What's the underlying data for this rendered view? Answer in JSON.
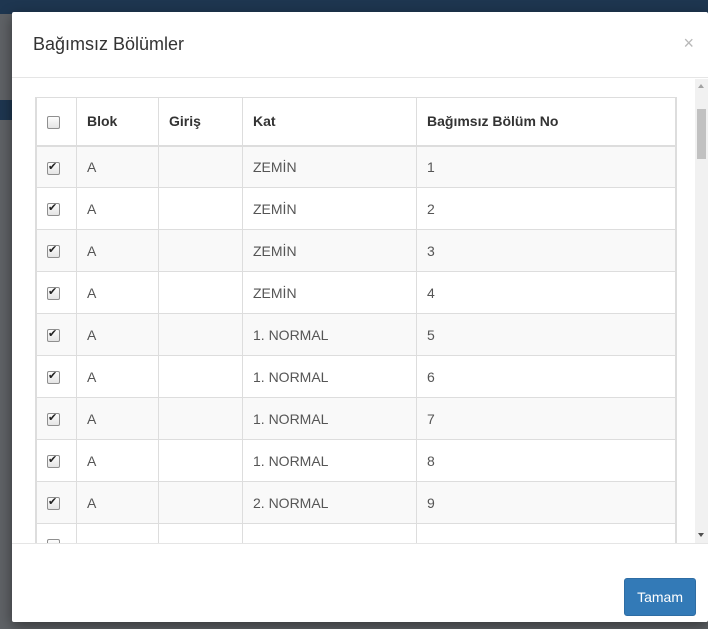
{
  "modal": {
    "title": "Bağımsız Bölümler",
    "close_symbol": "×",
    "ok_label": "Tamam"
  },
  "table": {
    "headers": {
      "blok": "Blok",
      "giris": "Giriş",
      "kat": "Kat",
      "bolum_no": "Bağımsız Bölüm No"
    },
    "header_checkbox_checked": false,
    "rows": [
      {
        "checked": true,
        "blok": "A",
        "giris": "",
        "kat": "ZEMİN",
        "bolum_no": "1"
      },
      {
        "checked": true,
        "blok": "A",
        "giris": "",
        "kat": "ZEMİN",
        "bolum_no": "2"
      },
      {
        "checked": true,
        "blok": "A",
        "giris": "",
        "kat": "ZEMİN",
        "bolum_no": "3"
      },
      {
        "checked": true,
        "blok": "A",
        "giris": "",
        "kat": "ZEMİN",
        "bolum_no": "4"
      },
      {
        "checked": true,
        "blok": "A",
        "giris": "",
        "kat": "1. NORMAL",
        "bolum_no": "5"
      },
      {
        "checked": true,
        "blok": "A",
        "giris": "",
        "kat": "1. NORMAL",
        "bolum_no": "6"
      },
      {
        "checked": true,
        "blok": "A",
        "giris": "",
        "kat": "1. NORMAL",
        "bolum_no": "7"
      },
      {
        "checked": true,
        "blok": "A",
        "giris": "",
        "kat": "1. NORMAL",
        "bolum_no": "8"
      },
      {
        "checked": true,
        "blok": "A",
        "giris": "",
        "kat": "2. NORMAL",
        "bolum_no": "9"
      },
      {
        "checked": false,
        "blok": "",
        "giris": "",
        "kat": "",
        "bolum_no": ""
      }
    ]
  },
  "colors": {
    "primary_button": "#337ab7",
    "header_bar": "#1e3650"
  }
}
